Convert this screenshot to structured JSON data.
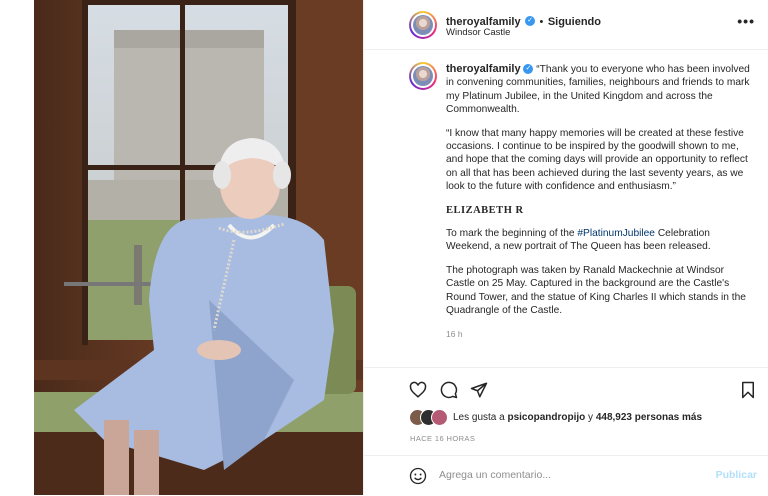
{
  "post": {
    "username": "theroyalfamily",
    "separator": "•",
    "follow_status": "Siguiendo",
    "location": "Windsor Castle",
    "more_icon": "more-horizontal-icon",
    "verified_icon": "verified-badge-icon"
  },
  "caption": {
    "username": "theroyalfamily",
    "p1": "“Thank you to everyone who has been involved in convening communities, families, neighbours and friends to mark my Platinum Jubilee, in the United Kingdom and across the Commonwealth.",
    "p2": "“I know that many happy memories will be created at these festive occasions. I continue to be inspired by the goodwill shown to me, and hope that the coming days will provide an opportunity to reflect on all that has been achieved during the last seventy years, as we look to the future with confidence and enthusiasm.”",
    "signature": "ELIZABETH R",
    "p4_before": "To mark the beginning of the ",
    "p4_hashtag": "#PlatinumJubilee",
    "p4_after": " Celebration Weekend, a new portrait of The Queen has been released.",
    "p5": "The photograph was taken by Ranald Mackechnie at Windsor Castle on 25 May. Captured in the background are the Castle's Round Tower, and the statue of King Charles II which stands in the Quadrangle of the Castle.",
    "time": "16 h"
  },
  "actions": {
    "icons": [
      "heart-icon",
      "comment-icon",
      "share-icon",
      "bookmark-icon"
    ]
  },
  "likes": {
    "prefix": "Les gusta a ",
    "user": "psicopandropijo",
    "middle": " y ",
    "count": "448,923 personas más"
  },
  "timestamp": "HACE 16 HORAS",
  "comment": {
    "placeholder": "Agrega un comentario...",
    "publish": "Publicar",
    "emoji_icon": "emoji-icon"
  }
}
